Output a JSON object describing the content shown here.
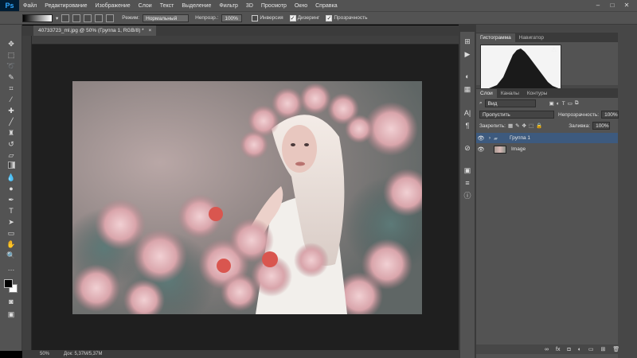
{
  "app": {
    "logo": "Ps",
    "menu": [
      "Файл",
      "Редактирование",
      "Изображение",
      "Слои",
      "Текст",
      "Выделение",
      "Фильтр",
      "3D",
      "Просмотр",
      "Окно",
      "Справка"
    ],
    "window_controls": {
      "minimize": "–",
      "restore": "□",
      "close": "✕"
    }
  },
  "options_bar": {
    "mode_label": "Режим:",
    "mode_value": "Нормальный",
    "opacity_label": "Непрозр.:",
    "opacity_value": "100%",
    "invert_label": "Инверсия",
    "dither_label": "Дизеринг",
    "transparency_label": "Прозрачность"
  },
  "document": {
    "tab_title": "40733723_ml.jpg @ 50% (Группа 1, RGB/8) *",
    "tab_close": "×",
    "zoom": "50%",
    "doc_size": "Док: 5,37M/5,37M"
  },
  "panels": {
    "histogram_tabs": [
      "Гистограмма",
      "Навигатор"
    ],
    "layers_tabs": [
      "Слои",
      "Каналы",
      "Контуры"
    ],
    "kind_filter": "Вид",
    "blend_mode": "Пропустить",
    "opacity_label": "Непрозрачность:",
    "opacity_value": "100%",
    "lock_label": "Закрепить:",
    "fill_label": "Заливка:",
    "fill_value": "100%",
    "layers": [
      {
        "name": "Группа 1",
        "selected": true
      },
      {
        "name": "Image",
        "selected": false
      }
    ]
  },
  "colors": {
    "ui_dark": "#535353",
    "workspace": "#1f1f1f",
    "selection": "#3d5a7e",
    "ps_blue": "#31a8ff"
  }
}
